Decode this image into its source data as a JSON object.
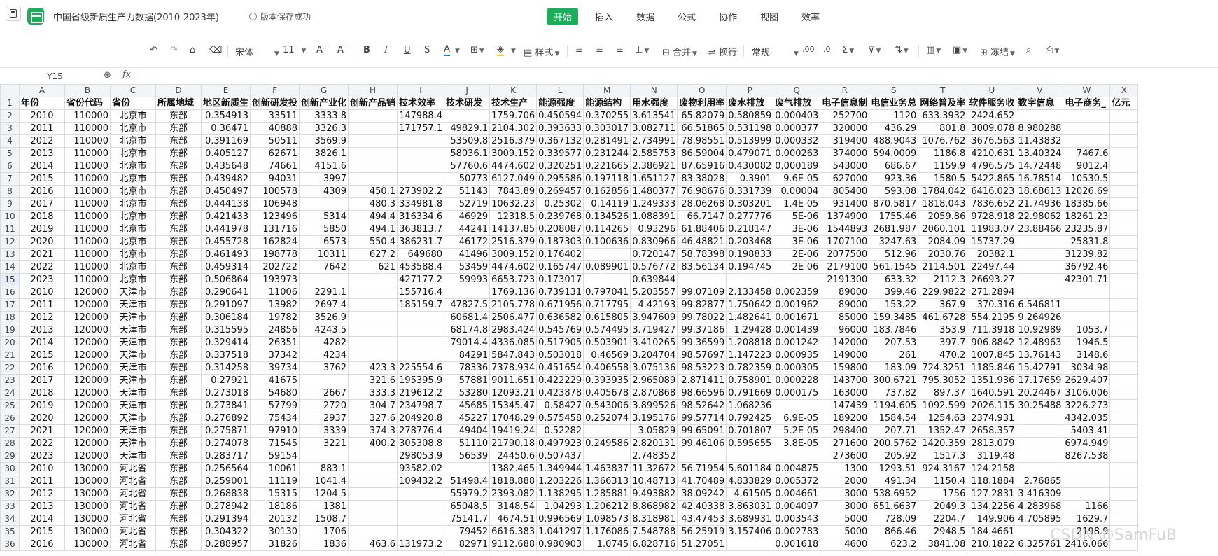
{
  "app": {
    "title": "中国省级新质生产力数据(2010-2023年)",
    "save_status": "版本保存成功",
    "accent_color": "#1aad5a"
  },
  "menu": [
    {
      "label": "开始",
      "active": true
    },
    {
      "label": "插入",
      "active": false
    },
    {
      "label": "数据",
      "active": false
    },
    {
      "label": "公式",
      "active": false
    },
    {
      "label": "协作",
      "active": false
    },
    {
      "label": "视图",
      "active": false
    },
    {
      "label": "效率",
      "active": false
    }
  ],
  "toolbar": {
    "font": "宋体",
    "size": "11",
    "style_label": "样式",
    "merge_label": "合并",
    "wrap_label": "换行",
    "format_label": "常规",
    "freeze_label": "冻结"
  },
  "formula_bar": {
    "cell_ref": "Y15",
    "fx_label": "fx",
    "content": ""
  },
  "sheet": {
    "columns": [
      "A",
      "B",
      "C",
      "D",
      "E",
      "F",
      "G",
      "H",
      "I",
      "J",
      "K",
      "L",
      "M",
      "N",
      "O",
      "P",
      "Q",
      "R",
      "S",
      "T",
      "U",
      "V",
      "W",
      "X"
    ],
    "row_numbers": [
      "1",
      "2",
      "3",
      "4",
      "5",
      "6",
      "7",
      "8",
      "9",
      "10",
      "11",
      "12",
      "13",
      "14",
      "15",
      "16",
      "17",
      "18",
      "19",
      "20",
      "21",
      "22",
      "23",
      "24",
      "25",
      "26",
      "27",
      "28",
      "29",
      "30",
      "31",
      "32",
      "33",
      "34",
      "35",
      "36"
    ],
    "selected_row": "15",
    "headers": [
      "年份",
      "省份代码",
      "省份",
      "所属地域",
      "地区新质生",
      "创新研发投",
      "创新产业化",
      "创新产品销",
      "技术效率",
      "技术研发",
      "技术生产",
      "能源强度",
      "能源结构",
      "用水强度",
      "废物利用率",
      "废水排放",
      "废气排放",
      "电子信息制",
      "电信业务总",
      "网络普及率",
      "软件服务收",
      "数字信息",
      "电子商务_",
      "亿元"
    ],
    "rows": [
      [
        "2010",
        "110000",
        "北京市",
        "东部",
        "0.354913",
        "33511",
        "3333.8",
        "",
        "147988.4",
        "",
        "1759.706",
        "0.450594",
        "0.370255",
        "3.613541",
        "65.82079",
        "0.580859",
        "0.000403",
        "252700",
        "1120",
        "633.3932",
        "2424.652",
        "",
        "",
        ""
      ],
      [
        "2011",
        "110000",
        "北京市",
        "东部",
        "0.36471",
        "40888",
        "3326.3",
        "",
        "171757.1",
        "49829.1",
        "2104.302",
        "0.393633",
        "0.303017",
        "3.082711",
        "66.51865",
        "0.531198",
        "0.000377",
        "320000",
        "436.29",
        "801.8",
        "3009.078",
        "8.980288",
        "",
        ""
      ],
      [
        "2012",
        "110000",
        "北京市",
        "东部",
        "0.391169",
        "50511",
        "3569.9",
        "",
        "",
        "53509.8",
        "2516.379",
        "0.367132",
        "0.281491",
        "2.734991",
        "78.98551",
        "0.513999",
        "0.000332",
        "319400",
        "488.9043",
        "1076.762",
        "3676.563",
        "11.43832",
        "",
        ""
      ],
      [
        "2013",
        "110000",
        "北京市",
        "东部",
        "0.405127",
        "62671",
        "3826.1",
        "",
        "",
        "58036.1",
        "3009.152",
        "0.339577",
        "0.231244",
        "2.585753",
        "86.59004",
        "0.479071",
        "0.000263",
        "374000",
        "594.0009",
        "1186.8",
        "4210.631",
        "13.40324",
        "7467.6",
        ""
      ],
      [
        "2014",
        "110000",
        "北京市",
        "东部",
        "0.435648",
        "74661",
        "4151.6",
        "",
        "",
        "57760.6",
        "4474.602",
        "0.320251",
        "0.221665",
        "2.386921",
        "87.65916",
        "0.430082",
        "0.000189",
        "543000",
        "686.67",
        "1159.9",
        "4796.575",
        "14.72448",
        "9012.4",
        ""
      ],
      [
        "2015",
        "110000",
        "北京市",
        "东部",
        "0.439482",
        "94031",
        "3997",
        "",
        "",
        "50773",
        "6127.049",
        "0.295586",
        "0.197118",
        "1.651127",
        "83.38028",
        "0.3901",
        "9.6E-05",
        "627000",
        "923.36",
        "1580.5",
        "5422.865",
        "16.78514",
        "10530.5",
        ""
      ],
      [
        "2016",
        "110000",
        "北京市",
        "东部",
        "0.450497",
        "100578",
        "4309",
        "450.1",
        "273902.2",
        "51143",
        "7843.89",
        "0.269457",
        "0.162856",
        "1.480377",
        "76.98676",
        "0.331739",
        "0.00004",
        "805400",
        "593.08",
        "1784.042",
        "6416.023",
        "18.68613",
        "12026.69",
        ""
      ],
      [
        "2017",
        "110000",
        "北京市",
        "东部",
        "0.444138",
        "106948",
        "",
        "480.3",
        "334981.8",
        "52719",
        "10632.23",
        "0.25302",
        "0.14119",
        "1.249333",
        "28.06268",
        "0.303201",
        "1.4E-05",
        "931400",
        "870.5817",
        "1818.043",
        "7836.652",
        "21.74936",
        "18385.66",
        ""
      ],
      [
        "2018",
        "110000",
        "北京市",
        "东部",
        "0.421433",
        "123496",
        "5314",
        "494.4",
        "316334.6",
        "46929",
        "12318.5",
        "0.239768",
        "0.134526",
        "1.088391",
        "66.7147",
        "0.277776",
        "5E-06",
        "1374900",
        "1755.46",
        "2059.86",
        "9728.918",
        "22.98062",
        "18261.23",
        ""
      ],
      [
        "2019",
        "110000",
        "北京市",
        "东部",
        "0.441978",
        "131716",
        "5850",
        "494.1",
        "363813.7",
        "44241",
        "14137.85",
        "0.208087",
        "0.114265",
        "0.93296",
        "61.88406",
        "0.218147",
        "3E-06",
        "1544893",
        "2681.987",
        "2060.101",
        "11983.07",
        "23.88466",
        "23235.87",
        ""
      ],
      [
        "2020",
        "110000",
        "北京市",
        "东部",
        "0.455728",
        "162824",
        "6573",
        "550.4",
        "386231.7",
        "46172",
        "2516.379",
        "0.187303",
        "0.100636",
        "0.830966",
        "46.48821",
        "0.203468",
        "3E-06",
        "1707100",
        "3247.63",
        "2084.09",
        "15737.29",
        "",
        "25831.8",
        ""
      ],
      [
        "2021",
        "110000",
        "北京市",
        "东部",
        "0.461493",
        "198778",
        "10311",
        "627.2",
        "649680",
        "41496",
        "3009.152",
        "0.176402",
        "",
        "0.720147",
        "58.78398",
        "0.198833",
        "2E-06",
        "2077500",
        "512.96",
        "2030.76",
        "20382.1",
        "",
        "31239.82",
        ""
      ],
      [
        "2022",
        "110000",
        "北京市",
        "东部",
        "0.459314",
        "202722",
        "7642",
        "621",
        "453588.4",
        "53459",
        "4474.602",
        "0.165747",
        "0.089901",
        "0.576772",
        "83.56134",
        "0.194745",
        "2E-06",
        "2179100",
        "561.1545",
        "2114.501",
        "22497.44",
        "",
        "36792.46",
        ""
      ],
      [
        "2023",
        "110000",
        "北京市",
        "东部",
        "0.506864",
        "193973",
        "",
        "",
        "427177.2",
        "59993",
        "6653.723",
        "0.173017",
        "",
        "0.639844",
        "",
        "",
        "",
        "2191300",
        "633.32",
        "2112.3",
        "26693.27",
        "",
        "42301.71",
        ""
      ],
      [
        "2010",
        "120000",
        "天津市",
        "东部",
        "0.290641",
        "11006",
        "2291.1",
        "",
        "155716.4",
        "",
        "1769.136",
        "0.739131",
        "0.797041",
        "5.203557",
        "99.07109",
        "2.133458",
        "0.002359",
        "89000",
        "399.46",
        "229.9822",
        "271.2894",
        "",
        "",
        ""
      ],
      [
        "2011",
        "120000",
        "天津市",
        "东部",
        "0.291097",
        "13982",
        "2697.4",
        "",
        "185159.7",
        "47827.5",
        "2105.778",
        "0.671956",
        "0.717795",
        "4.42193",
        "99.82877",
        "1.750642",
        "0.001962",
        "89000",
        "153.22",
        "367.9",
        "370.316",
        "6.546811",
        "",
        ""
      ],
      [
        "2012",
        "120000",
        "天津市",
        "东部",
        "0.306184",
        "19782",
        "3526.9",
        "",
        "",
        "60681.4",
        "2506.477",
        "0.636582",
        "0.615805",
        "3.947609",
        "99.78022",
        "1.482641",
        "0.001671",
        "85000",
        "159.3485",
        "461.6728",
        "554.2195",
        "9.264926",
        "",
        ""
      ],
      [
        "2013",
        "120000",
        "天津市",
        "东部",
        "0.315595",
        "24856",
        "4243.5",
        "",
        "",
        "68174.8",
        "2983.424",
        "0.545769",
        "0.574495",
        "3.719427",
        "99.37186",
        "1.29428",
        "0.001439",
        "96000",
        "183.7846",
        "353.9",
        "711.3918",
        "10.92989",
        "1053.7",
        ""
      ],
      [
        "2014",
        "120000",
        "天津市",
        "东部",
        "0.329414",
        "26351",
        "4282",
        "",
        "",
        "79014.4",
        "4336.085",
        "0.517905",
        "0.503901",
        "3.410265",
        "99.36599",
        "1.208818",
        "0.001242",
        "142000",
        "207.53",
        "397.7",
        "906.8842",
        "12.48963",
        "1946.5",
        ""
      ],
      [
        "2015",
        "120000",
        "天津市",
        "东部",
        "0.337518",
        "37342",
        "4234",
        "",
        "",
        "84291",
        "5847.843",
        "0.503018",
        "0.46569",
        "3.204704",
        "98.57697",
        "1.147223",
        "0.000935",
        "149000",
        "261",
        "470.2",
        "1007.845",
        "13.76143",
        "3148.6",
        ""
      ],
      [
        "2016",
        "120000",
        "天津市",
        "东部",
        "0.314258",
        "39734",
        "3762",
        "423.3",
        "225554.6",
        "78336",
        "7378.934",
        "0.451654",
        "0.406558",
        "3.075136",
        "98.53223",
        "0.782359",
        "0.000305",
        "159800",
        "183.09",
        "724.3251",
        "1185.846",
        "15.42791",
        "3034.98",
        ""
      ],
      [
        "2017",
        "120000",
        "天津市",
        "东部",
        "0.27921",
        "41675",
        "",
        "321.6",
        "195395.9",
        "57881",
        "9011.651",
        "0.422229",
        "0.393935",
        "2.965089",
        "2.871411",
        "0.758901",
        "0.000228",
        "143700",
        "300.6721",
        "795.3052",
        "1351.936",
        "17.17659",
        "2629.407",
        ""
      ],
      [
        "2018",
        "120000",
        "天津市",
        "东部",
        "0.273018",
        "54680",
        "2667",
        "333.3",
        "219612.2",
        "53280",
        "12093.21",
        "0.423878",
        "0.405678",
        "2.870868",
        "98.66596",
        "0.791669",
        "0.000175",
        "163000",
        "737.82",
        "897.37",
        "1640.591",
        "20.24467",
        "3106.006",
        ""
      ],
      [
        "2019",
        "120000",
        "天津市",
        "东部",
        "0.273841",
        "57799",
        "2720",
        "304.7",
        "234798.7",
        "45685",
        "15345.47",
        "0.58427",
        "0.543006",
        "3.899526",
        "98.52642",
        "1.068236",
        "",
        "147439",
        "1194.605",
        "1092.599",
        "2026.115",
        "30.25488",
        "3226.273",
        ""
      ],
      [
        "2020",
        "120000",
        "天津市",
        "东部",
        "0.276892",
        "75434",
        "2937",
        "327.6",
        "204920.8",
        "45227",
        "17048.29",
        "0.575458",
        "0.252074",
        "3.195176",
        "99.57714",
        "0.792425",
        "6.9E-05",
        "189200",
        "1584.54",
        "1254.63",
        "2374.931",
        "",
        "4342.035",
        ""
      ],
      [
        "2021",
        "120000",
        "天津市",
        "东部",
        "0.275871",
        "97910",
        "3339",
        "374.3",
        "278776.4",
        "49404",
        "19419.24",
        "0.52282",
        "",
        "3.05829",
        "99.65091",
        "0.701807",
        "5.2E-05",
        "298400",
        "207.71",
        "1352.47",
        "2658.357",
        "",
        "5403.41",
        ""
      ],
      [
        "2022",
        "120000",
        "天津市",
        "东部",
        "0.274078",
        "71545",
        "3221",
        "400.2",
        "305308.8",
        "51110",
        "21790.18",
        "0.497923",
        "0.249586",
        "2.820131",
        "99.46106",
        "0.595655",
        "3.8E-05",
        "271600",
        "200.5762",
        "1420.359",
        "2813.079",
        "",
        "6974.949",
        ""
      ],
      [
        "2023",
        "120000",
        "天津市",
        "东部",
        "0.283717",
        "59154",
        "",
        "",
        "298053.9",
        "56539",
        "24450.6",
        "0.507437",
        "",
        "2.748352",
        "",
        "",
        "",
        "273600",
        "205.92",
        "1517.3",
        "3119.48",
        "",
        "8267.538",
        ""
      ],
      [
        "2010",
        "130000",
        "河北省",
        "东部",
        "0.256564",
        "10061",
        "883.1",
        "",
        "93582.02",
        "",
        "1382.465",
        "1.349944",
        "1.463837",
        "11.32672",
        "56.71954",
        "5.601184",
        "0.004875",
        "1300",
        "1293.51",
        "924.3167",
        "124.2158",
        "",
        "",
        ""
      ],
      [
        "2011",
        "130000",
        "河北省",
        "东部",
        "0.259001",
        "11119",
        "1041.4",
        "",
        "109432.2",
        "51498.4",
        "1818.888",
        "1.203226",
        "1.366313",
        "10.48713",
        "41.70489",
        "4.833829",
        "0.005372",
        "2000",
        "491.34",
        "1150.4",
        "118.1884",
        "2.76865",
        "",
        ""
      ],
      [
        "2012",
        "130000",
        "河北省",
        "东部",
        "0.268838",
        "15315",
        "1204.5",
        "",
        "",
        "55979.2",
        "2393.082",
        "1.138295",
        "1.285881",
        "9.493882",
        "38.09242",
        "4.61505",
        "0.004661",
        "3000",
        "538.6952",
        "1756",
        "127.2831",
        "3.416309",
        "",
        ""
      ],
      [
        "2013",
        "130000",
        "河北省",
        "东部",
        "0.278942",
        "18186",
        "1381",
        "",
        "",
        "65048.5",
        "3148.54",
        "1.04293",
        "1.206212",
        "8.868982",
        "42.40338",
        "3.863031",
        "0.004097",
        "3000",
        "651.6637",
        "2049.3",
        "134.2256",
        "4.283968",
        "1166",
        ""
      ],
      [
        "2014",
        "130000",
        "河北省",
        "东部",
        "0.291394",
        "20132",
        "1508.7",
        "",
        "",
        "75141.7",
        "4674.51",
        "0.996569",
        "1.098573",
        "8.318981",
        "43.47453",
        "3.689931",
        "0.003543",
        "5000",
        "728.09",
        "2204.7",
        "149.906",
        "4.705895",
        "1629.7",
        ""
      ],
      [
        "2015",
        "130000",
        "河北省",
        "东部",
        "0.304322",
        "30130",
        "1706",
        "",
        "",
        "79452",
        "6616.383",
        "1.041297",
        "1.176086",
        "7.548788",
        "56.25919",
        "3.157406",
        "0.002783",
        "5000",
        "866.46",
        "2948.5",
        "184.4661",
        "",
        "2198.9",
        ""
      ],
      [
        "2016",
        "130000",
        "河北省",
        "东部",
        "0.288957",
        "31826",
        "1836",
        "463.6",
        "131973.2",
        "82971",
        "9112.688",
        "0.980903",
        "1.0745",
        "6.828716",
        "51.27051",
        "",
        "0.001618",
        "4600",
        "623.2",
        "3841.08",
        "210.1822",
        "6.325761",
        "2416.066",
        ""
      ]
    ]
  },
  "watermark": "CSDN @SamFuB"
}
